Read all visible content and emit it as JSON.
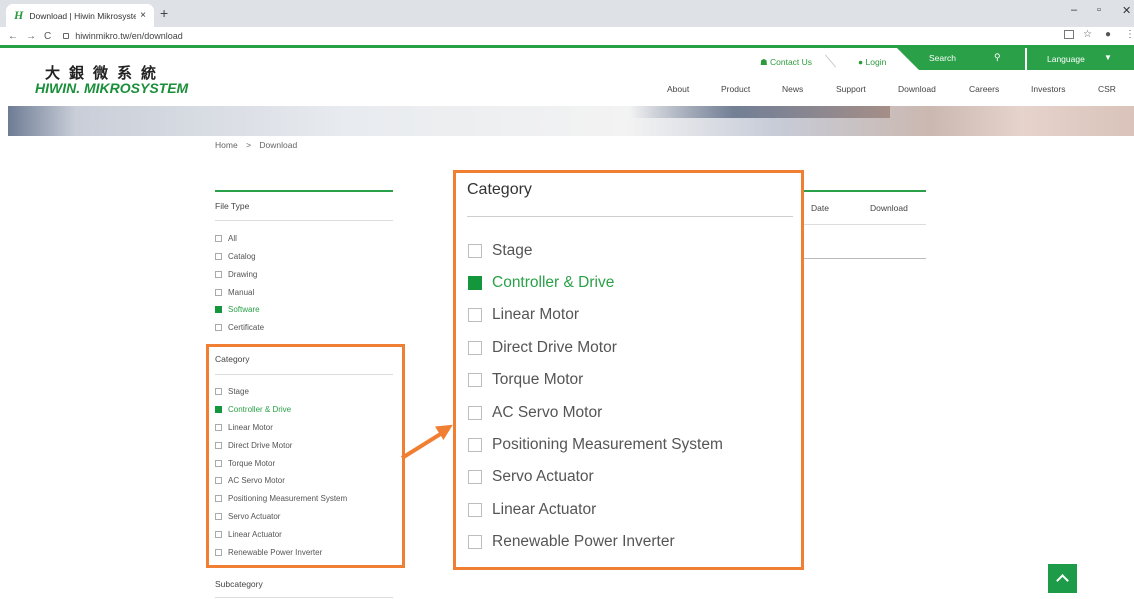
{
  "browser": {
    "tab_favicon": "H",
    "tab_title": "Download | Hiwin Mikrosystem",
    "tab_close": "×",
    "new_tab": "+",
    "back": "←",
    "forward": "→",
    "reload": "C",
    "url": "hiwinmikro.tw/en/download",
    "minimize": "–",
    "maximize": "▫",
    "close": "✕",
    "star_icon": "☆",
    "account_icon": "●",
    "menu_icon": "⋮"
  },
  "header": {
    "logo_cn": "大銀微系統",
    "logo_en": "HIWIN. MIKROSYSTEM",
    "contact_label": "Contact Us",
    "login_label": "Login",
    "search_label": "Search",
    "language_label": "Language",
    "nav": [
      "About",
      "Product",
      "News",
      "Support",
      "Download",
      "Careers",
      "Investors",
      "CSR"
    ],
    "brand_color": "#2aa148"
  },
  "breadcrumb": {
    "home": "Home",
    "separator": ">",
    "current": "Download"
  },
  "filters": {
    "file_type": {
      "title": "File Type",
      "options": [
        {
          "label": "All",
          "checked": false
        },
        {
          "label": "Catalog",
          "checked": false
        },
        {
          "label": "Drawing",
          "checked": false
        },
        {
          "label": "Manual",
          "checked": false
        },
        {
          "label": "Software",
          "checked": true
        },
        {
          "label": "Certificate",
          "checked": false
        }
      ]
    },
    "category": {
      "title": "Category",
      "options": [
        {
          "label": "Stage",
          "checked": false
        },
        {
          "label": "Controller & Drive",
          "checked": true
        },
        {
          "label": "Linear Motor",
          "checked": false
        },
        {
          "label": "Direct Drive Motor",
          "checked": false
        },
        {
          "label": "Torque Motor",
          "checked": false
        },
        {
          "label": "AC Servo Motor",
          "checked": false
        },
        {
          "label": "Positioning Measurement System",
          "checked": false
        },
        {
          "label": "Servo Actuator",
          "checked": false
        },
        {
          "label": "Linear Actuator",
          "checked": false
        },
        {
          "label": "Renewable Power Inverter",
          "checked": false
        }
      ]
    },
    "subcategory": {
      "title": "Subcategory"
    }
  },
  "table": {
    "columns": [
      "Date",
      "Download"
    ]
  },
  "highlight_color": "#f07f33"
}
